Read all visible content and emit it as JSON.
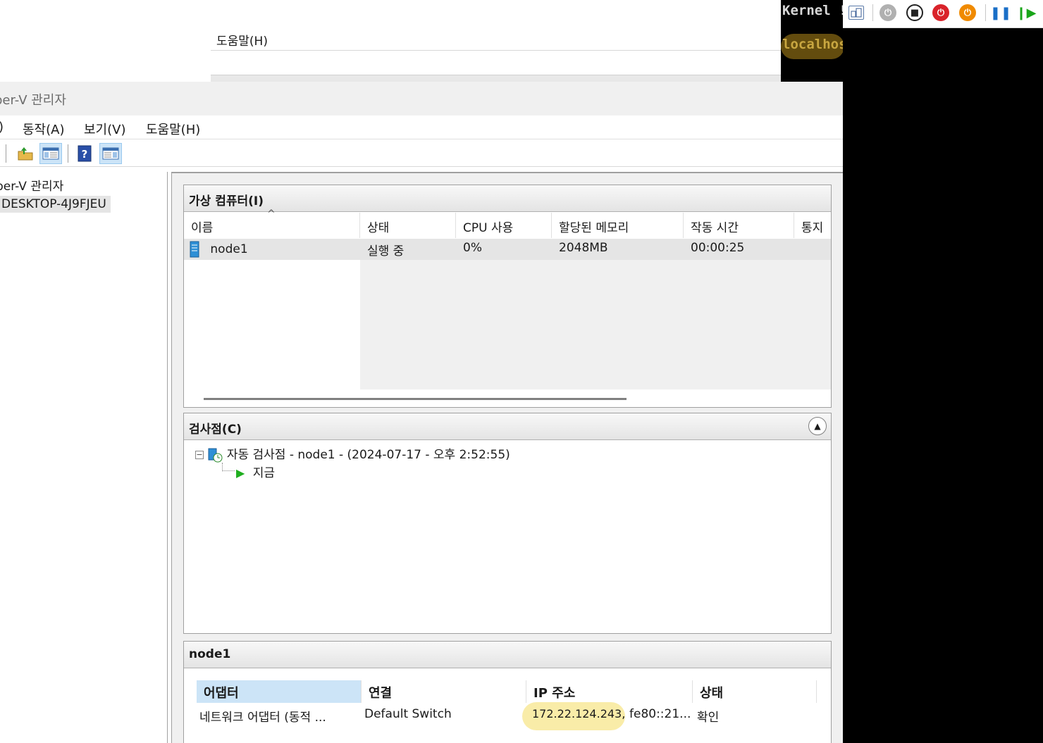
{
  "background_window": {
    "help_menu": "도움말(H)"
  },
  "console": {
    "line1": "Kernel !",
    "line2": "localhos"
  },
  "vm_toolbar": {
    "icons": [
      "ctrl-alt-del-icon",
      "start-icon",
      "turn-off-icon",
      "shutdown-icon",
      "power-icon",
      "pause-icon",
      "resume-icon"
    ]
  },
  "titlebar": {
    "title": "per-V 관리자"
  },
  "menu": {
    "file_tail": ")",
    "action": "동작(A)",
    "view": "보기(V)",
    "help": "도움말(H)"
  },
  "tree": {
    "root": "per-V 관리자",
    "host": "DESKTOP-4J9FJEU"
  },
  "vm_panel": {
    "title": "가상 컴퓨터(I)",
    "columns": [
      "이름",
      "상태",
      "CPU 사용",
      "할당된 메모리",
      "작동 시간",
      "통지"
    ],
    "rows": [
      {
        "name": "node1",
        "state": "실행 중",
        "cpu": "0%",
        "memory": "2048MB",
        "uptime": "00:00:25",
        "notice": ""
      }
    ]
  },
  "checkpoint_panel": {
    "title": "검사점(C)",
    "checkpoint": "자동 검사점 - node1 - (2024-07-17 - 오후 2:52:55)",
    "now": "지금"
  },
  "details_panel": {
    "title": "node1",
    "columns": [
      "어댑터",
      "연결",
      "IP 주소",
      "상태"
    ],
    "rows": [
      {
        "adapter": "네트워크 어댑터 (동적 ...",
        "connection": "Default Switch",
        "ip_v4": "172.22.124.243,",
        "ip_v6": "fe80::21...",
        "status": "확인"
      }
    ]
  }
}
